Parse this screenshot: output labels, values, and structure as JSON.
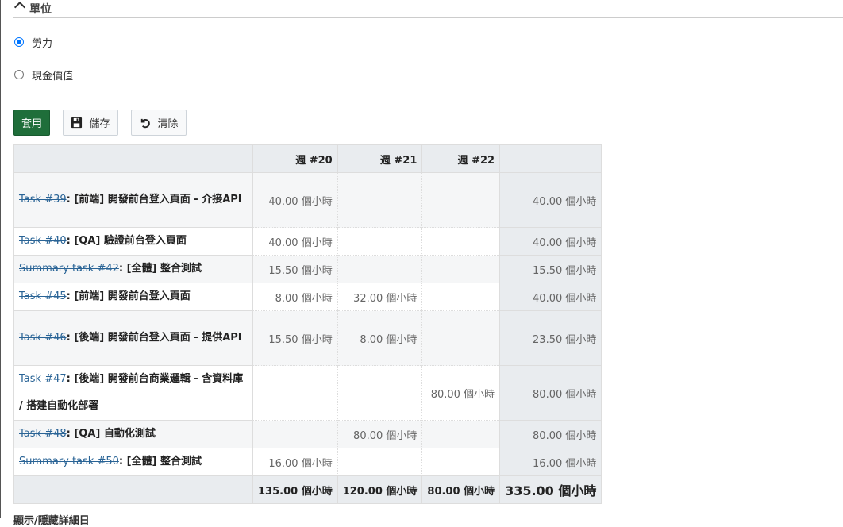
{
  "section": {
    "title": "單位"
  },
  "units": {
    "options": [
      {
        "label": "勞力",
        "checked": true
      },
      {
        "label": "現金價值",
        "checked": false
      }
    ]
  },
  "buttons": {
    "apply": "套用",
    "save": "儲存",
    "clear": "清除"
  },
  "table": {
    "headers": [
      "",
      "週 #20",
      "週 #21",
      "週 #22",
      ""
    ],
    "rows": [
      {
        "link": "Task #39",
        "title": ": [前端] 開發前台登入頁面 - 介接API",
        "w20": "40.00 個小時",
        "w21": "",
        "w22": "",
        "total": "40.00 個小時"
      },
      {
        "link": "Task #40",
        "title": ": [QA] 驗證前台登入頁面",
        "w20": "40.00 個小時",
        "w21": "",
        "w22": "",
        "total": "40.00 個小時"
      },
      {
        "link": "Summary task #42",
        "title": ": [全體] 整合測試",
        "w20": "15.50 個小時",
        "w21": "",
        "w22": "",
        "total": "15.50 個小時"
      },
      {
        "link": "Task #45",
        "title": ": [前端] 開發前台登入頁面",
        "w20": "8.00 個小時",
        "w21": "32.00 個小時",
        "w22": "",
        "total": "40.00 個小時"
      },
      {
        "link": "Task #46",
        "title": ": [後端] 開發前台登入頁面 - 提供API",
        "w20": "15.50 個小時",
        "w21": "8.00 個小時",
        "w22": "",
        "total": "23.50 個小時"
      },
      {
        "link": "Task #47",
        "title": ": [後端] 開發前台商業邏輯 - 含資料庫 / 搭建自動化部署",
        "w20": "",
        "w21": "",
        "w22": "80.00 個小時",
        "total": "80.00 個小時"
      },
      {
        "link": "Task #48",
        "title": ": [QA] 自動化測試",
        "w20": "",
        "w21": "80.00 個小時",
        "w22": "",
        "total": "80.00 個小時"
      },
      {
        "link": "Summary task #50",
        "title": ": [全體] 整合測試",
        "w20": "16.00 個小時",
        "w21": "",
        "w22": "",
        "total": "16.00 個小時"
      }
    ],
    "totals": {
      "w20": "135.00 個小時",
      "w21": "120.00 個小時",
      "w22": "80.00 個小時",
      "grand": "335.00 個小時"
    }
  },
  "footer": {
    "text": "顯示/隱藏詳細日"
  }
}
